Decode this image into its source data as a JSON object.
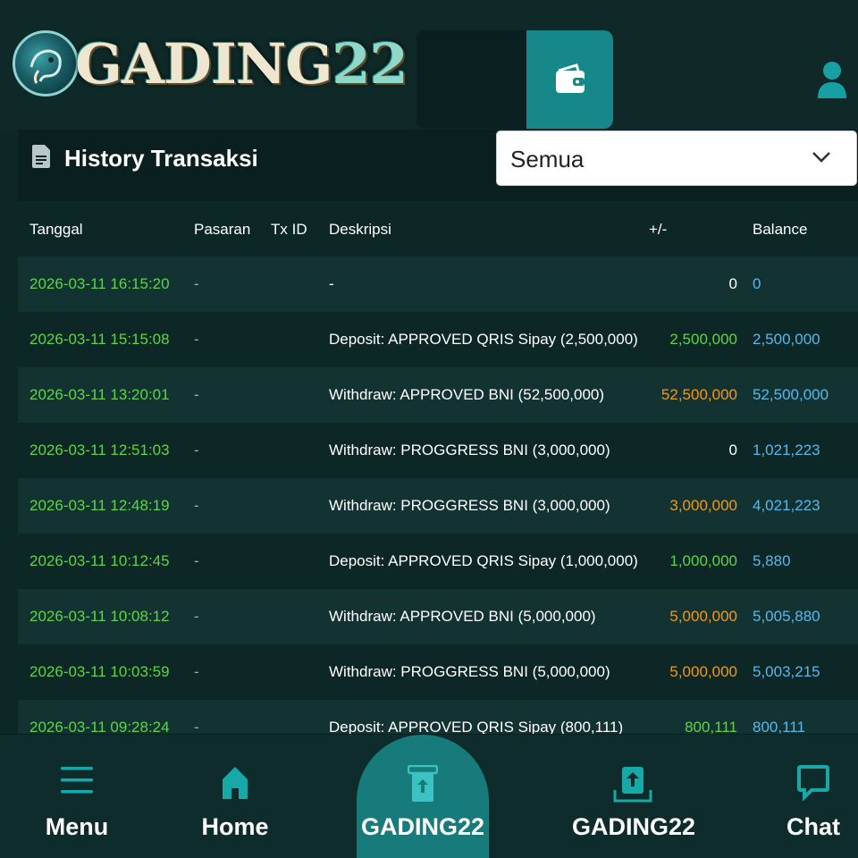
{
  "brand": {
    "logo_text": "GADING",
    "logo_number": "22"
  },
  "colors": {
    "accent": "#16888a",
    "bg": "#0d2626",
    "positive": "#5fd34a",
    "negative": "#ee9a1a",
    "balance": "#58b8ea"
  },
  "history": {
    "title": "History Transaksi",
    "filter_selected": "Semua"
  },
  "table": {
    "headers": {
      "tanggal": "Tanggal",
      "pasaran": "Pasaran",
      "txid": "Tx ID",
      "deskripsi": "Deskripsi",
      "change": "+/-",
      "balance": "Balance"
    },
    "rows": [
      {
        "date": "2026-03-11 16:15:20",
        "pasaran": "-",
        "desc": "-",
        "amount": "0",
        "amount_color": "#ffffff",
        "balance": "0"
      },
      {
        "date": "2026-03-11 15:15:08",
        "pasaran": "-",
        "desc": "Deposit: APPROVED QRIS Sipay (2,500,000)",
        "amount": "2,500,000",
        "amount_color": "#5fd34a",
        "balance": "2,500,000"
      },
      {
        "date": "2026-03-11 13:20:01",
        "pasaran": "-",
        "desc": "Withdraw: APPROVED BNI (52,500,000)",
        "amount": "52,500,000",
        "amount_color": "#ee9a1a",
        "balance": "52,500,000"
      },
      {
        "date": "2026-03-11 12:51:03",
        "pasaran": "-",
        "desc": "Withdraw: PROGGRESS BNI (3,000,000)",
        "amount": "0",
        "amount_color": "#ffffff",
        "balance": "1,021,223"
      },
      {
        "date": "2026-03-11 12:48:19",
        "pasaran": "-",
        "desc": "Withdraw: PROGGRESS BNI (3,000,000)",
        "amount": "3,000,000",
        "amount_color": "#ee9a1a",
        "balance": "4,021,223"
      },
      {
        "date": "2026-03-11 10:12:45",
        "pasaran": "-",
        "desc": "Deposit: APPROVED QRIS Sipay (1,000,000)",
        "amount": "1,000,000",
        "amount_color": "#5fd34a",
        "balance": "5,880"
      },
      {
        "date": "2026-03-11 10:08:12",
        "pasaran": "-",
        "desc": "Withdraw: APPROVED BNI (5,000,000)",
        "amount": "5,000,000",
        "amount_color": "#ee9a1a",
        "balance": "5,005,880"
      },
      {
        "date": "2026-03-11 10:03:59",
        "pasaran": "-",
        "desc": "Withdraw: PROGGRESS BNI (5,000,000)",
        "amount": "5,000,000",
        "amount_color": "#ee9a1a",
        "balance": "5,003,215"
      },
      {
        "date": "2026-03-11 09:28:24",
        "pasaran": "-",
        "desc": "Deposit: APPROVED QRIS Sipay (800,111)",
        "amount": "800,111",
        "amount_color": "#5fd34a",
        "balance": "800,111"
      }
    ]
  },
  "bottom_nav": {
    "menu": "Menu",
    "home": "Home",
    "center": "GADING22",
    "withdraw": "GADING22",
    "chat": "Chat"
  }
}
